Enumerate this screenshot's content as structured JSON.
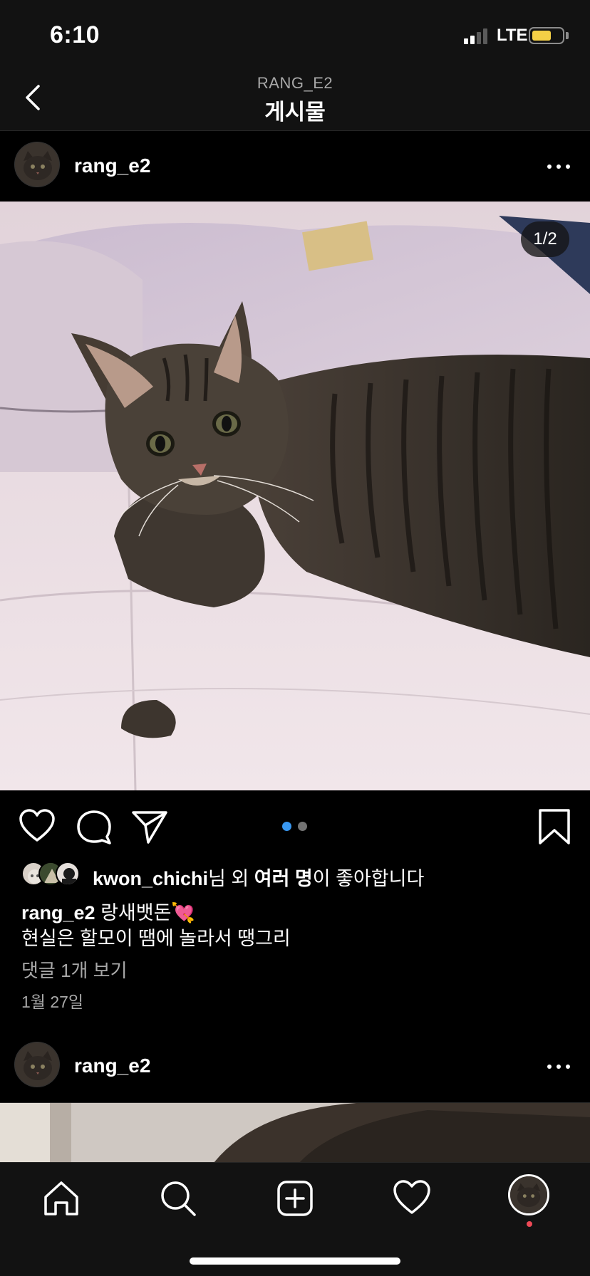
{
  "status_bar": {
    "time": "6:10",
    "network": "LTE",
    "battery_color": "#f4cf46"
  },
  "nav": {
    "subtitle": "RANG_E2",
    "title": "게시물",
    "back_icon": "chevron-left-icon"
  },
  "post": {
    "username": "rang_e2",
    "photo_counter": "1/2",
    "carousel": {
      "count": 2,
      "active_index": 0,
      "active_color": "#3897f0",
      "inactive_color": "#737373"
    },
    "likes": {
      "user": "kwon_chichi",
      "text_mid": "님 외 ",
      "text_bold": "여러 명",
      "text_end": "이 좋아합니다"
    },
    "caption": {
      "username": "rang_e2",
      "line1": " 랑새뱃돈💘",
      "line2": "현실은 할모이 땜에 놀라서 땡그리"
    },
    "comments_link": "댓글 1개 보기",
    "date": "1월 27일"
  },
  "next_post": {
    "username": "rang_e2"
  },
  "tab_bar": {
    "items": [
      "home-icon",
      "search-icon",
      "new-post-icon",
      "activity-heart-icon",
      "profile-avatar"
    ],
    "notification_color": "#ed4956"
  }
}
